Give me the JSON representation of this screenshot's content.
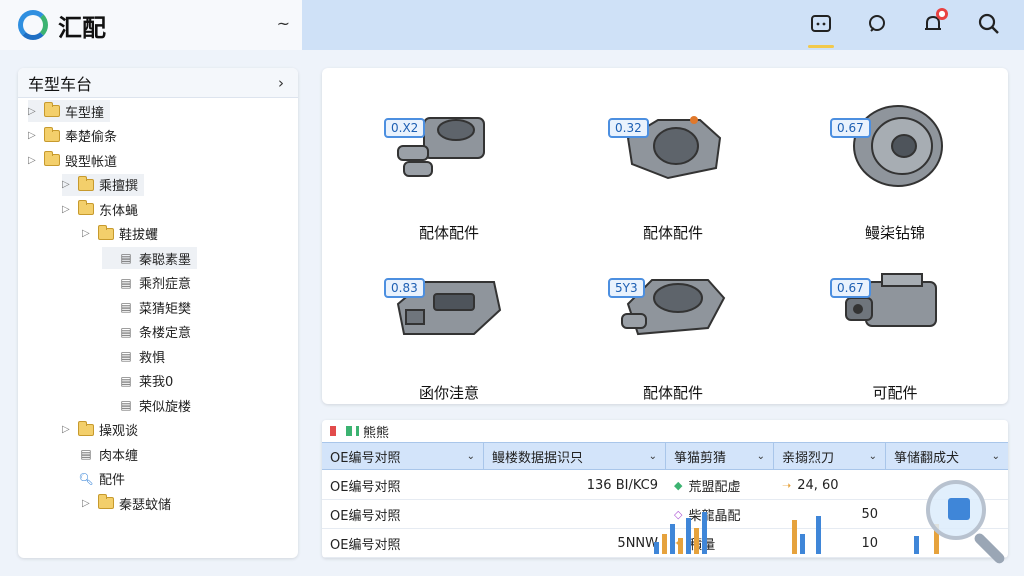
{
  "app": {
    "title": "汇配"
  },
  "topbar": {
    "collapse_glyph": "~",
    "icons": [
      {
        "name": "message-icon",
        "active": true
      },
      {
        "name": "support-icon",
        "active": false
      },
      {
        "name": "bell-icon",
        "active": false,
        "badge": "●"
      },
      {
        "name": "search-icon",
        "active": false
      }
    ]
  },
  "sidebar": {
    "title": "车型车台",
    "tree": [
      {
        "label": "车型撞",
        "level": 0,
        "icon": "folder"
      },
      {
        "label": "奉楚偷条",
        "level": 0,
        "icon": "folder"
      },
      {
        "label": "毁型帐道",
        "level": 1,
        "icon": "folder"
      },
      {
        "label": "乘擅撰",
        "level": 2,
        "icon": "folder"
      },
      {
        "label": "东体蝇",
        "level": 2,
        "icon": "folder"
      },
      {
        "label": "鞋拔蠼",
        "level": 3,
        "icon": "folder"
      },
      {
        "label": "秦聪素墨",
        "level": 4,
        "icon": "part"
      },
      {
        "label": "乘剂症意",
        "level": 4,
        "icon": "part"
      },
      {
        "label": "菜猜矩樊",
        "level": 4,
        "icon": "part"
      },
      {
        "label": "条楼定意",
        "level": 4,
        "icon": "part"
      },
      {
        "label": "救惧",
        "level": 4,
        "icon": "part"
      },
      {
        "label": "莱我0",
        "level": 4,
        "icon": "part"
      },
      {
        "label": "荣似旋楼",
        "level": 4,
        "icon": "part"
      },
      {
        "label": "操观谈",
        "level": 2,
        "icon": "folder"
      },
      {
        "label": "肉本缠",
        "level": 2,
        "icon": "part"
      },
      {
        "label": "配件",
        "level": 2,
        "icon": "search"
      },
      {
        "label": "秦瑟蚊储",
        "level": 3,
        "icon": "folder"
      }
    ]
  },
  "parts": [
    {
      "label": "配体配件",
      "confidence": "0.X2"
    },
    {
      "label": "配体配件",
      "confidence": "0.32"
    },
    {
      "label": "鳗柒钻锦",
      "confidence": "0.67"
    },
    {
      "label": "函你洼意",
      "confidence": "0.83"
    },
    {
      "label": "配体配件",
      "confidence": "5Y3"
    },
    {
      "label": "可配件",
      "confidence": "0.67"
    }
  ],
  "table": {
    "title": "熊熊",
    "columns": [
      "OE编号对照",
      "鳗楼数据据识只",
      "箏猫剪猜",
      "亲搦烈刀",
      "箏储翻成犬"
    ],
    "rows": [
      {
        "oe": "OE编号对照",
        "data": "136 BI/KC9",
        "status": "荒盟配虚",
        "value": "24, 60"
      },
      {
        "oe": "OE编号对照",
        "data": "",
        "status": "柴龍晶配",
        "value": "50"
      },
      {
        "oe": "OE编号对照",
        "data": "5NNW",
        "status": "積量",
        "value": "10"
      }
    ]
  },
  "colors": {
    "accent": "#4c8fe0",
    "topbar": "#cfe1f7",
    "folder": "#f3cf6b",
    "header": "#d3e4fa"
  }
}
